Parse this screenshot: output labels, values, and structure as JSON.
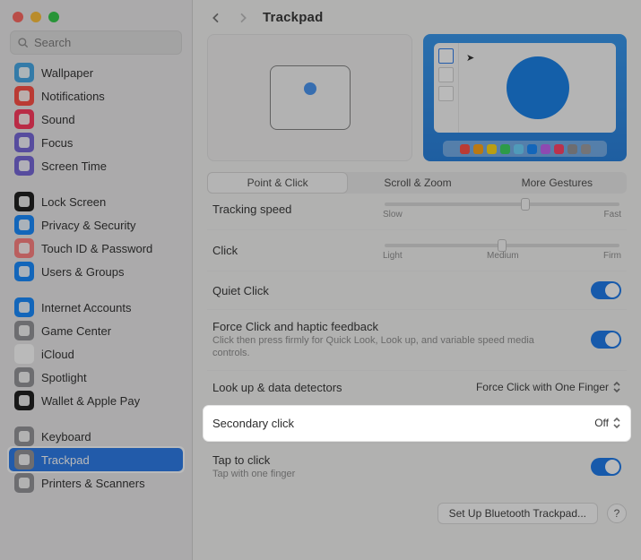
{
  "window": {
    "traffic": {
      "close": "#fe5f57",
      "min": "#febb2e",
      "max": "#28c840"
    },
    "search_placeholder": "Search"
  },
  "header": {
    "title": "Trackpad"
  },
  "sidebar": {
    "items": [
      {
        "label": "Wallpaper",
        "icon": "wallpaper",
        "bg": "#3aa3e5"
      },
      {
        "label": "Notifications",
        "icon": "bell",
        "bg": "#ff453a"
      },
      {
        "label": "Sound",
        "icon": "speaker",
        "bg": "#ff2d55"
      },
      {
        "label": "Focus",
        "icon": "moon",
        "bg": "#6e5dd6"
      },
      {
        "label": "Screen Time",
        "icon": "hourglass",
        "bg": "#6e5dd6"
      },
      {
        "label": "Lock Screen",
        "icon": "lock",
        "bg": "#111111"
      },
      {
        "label": "Privacy & Security",
        "icon": "hand",
        "bg": "#0a84ff"
      },
      {
        "label": "Touch ID & Password",
        "icon": "fingerprint",
        "bg": "#ff7a7a"
      },
      {
        "label": "Users & Groups",
        "icon": "users",
        "bg": "#0a84ff"
      },
      {
        "label": "Internet Accounts",
        "icon": "at",
        "bg": "#0a84ff"
      },
      {
        "label": "Game Center",
        "icon": "game",
        "bg": "#8e8e93"
      },
      {
        "label": "iCloud",
        "icon": "cloud",
        "bg": "#ffffff"
      },
      {
        "label": "Spotlight",
        "icon": "search",
        "bg": "#8e8e93"
      },
      {
        "label": "Wallet & Apple Pay",
        "icon": "wallet",
        "bg": "#111111"
      },
      {
        "label": "Keyboard",
        "icon": "keyboard",
        "bg": "#8e8e93"
      },
      {
        "label": "Trackpad",
        "icon": "trackpad",
        "bg": "#8e8e93",
        "selected": true
      },
      {
        "label": "Printers & Scanners",
        "icon": "printer",
        "bg": "#8e8e93"
      }
    ],
    "gaps_after": [
      4,
      8,
      13
    ]
  },
  "tabs": [
    {
      "label": "Point & Click",
      "active": true
    },
    {
      "label": "Scroll & Zoom"
    },
    {
      "label": "More Gestures"
    }
  ],
  "dock_colors": [
    "#ff453a",
    "#ff9f0a",
    "#ffd60a",
    "#30d158",
    "#64d2ff",
    "#0a84ff",
    "#bf5af2",
    "#ff375f",
    "#8e8e93",
    "#98989d"
  ],
  "settings": {
    "tracking": {
      "label": "Tracking speed",
      "value_pct": 60,
      "min_label": "Slow",
      "max_label": "Fast"
    },
    "click": {
      "label": "Click",
      "value_pct": 50,
      "min_label": "Light",
      "mid_label": "Medium",
      "max_label": "Firm"
    },
    "quiet": {
      "label": "Quiet Click",
      "on": true
    },
    "force": {
      "label": "Force Click and haptic feedback",
      "sub": "Click then press firmly for Quick Look, Look up, and variable speed media controls.",
      "on": true
    },
    "lookup": {
      "label": "Look up & data detectors",
      "value": "Force Click with One Finger"
    },
    "secondary": {
      "label": "Secondary click",
      "value": "Off"
    },
    "tap": {
      "label": "Tap to click",
      "sub": "Tap with one finger",
      "on": true
    }
  },
  "footer": {
    "bluetooth_btn": "Set Up Bluetooth Trackpad...",
    "help": "?"
  }
}
